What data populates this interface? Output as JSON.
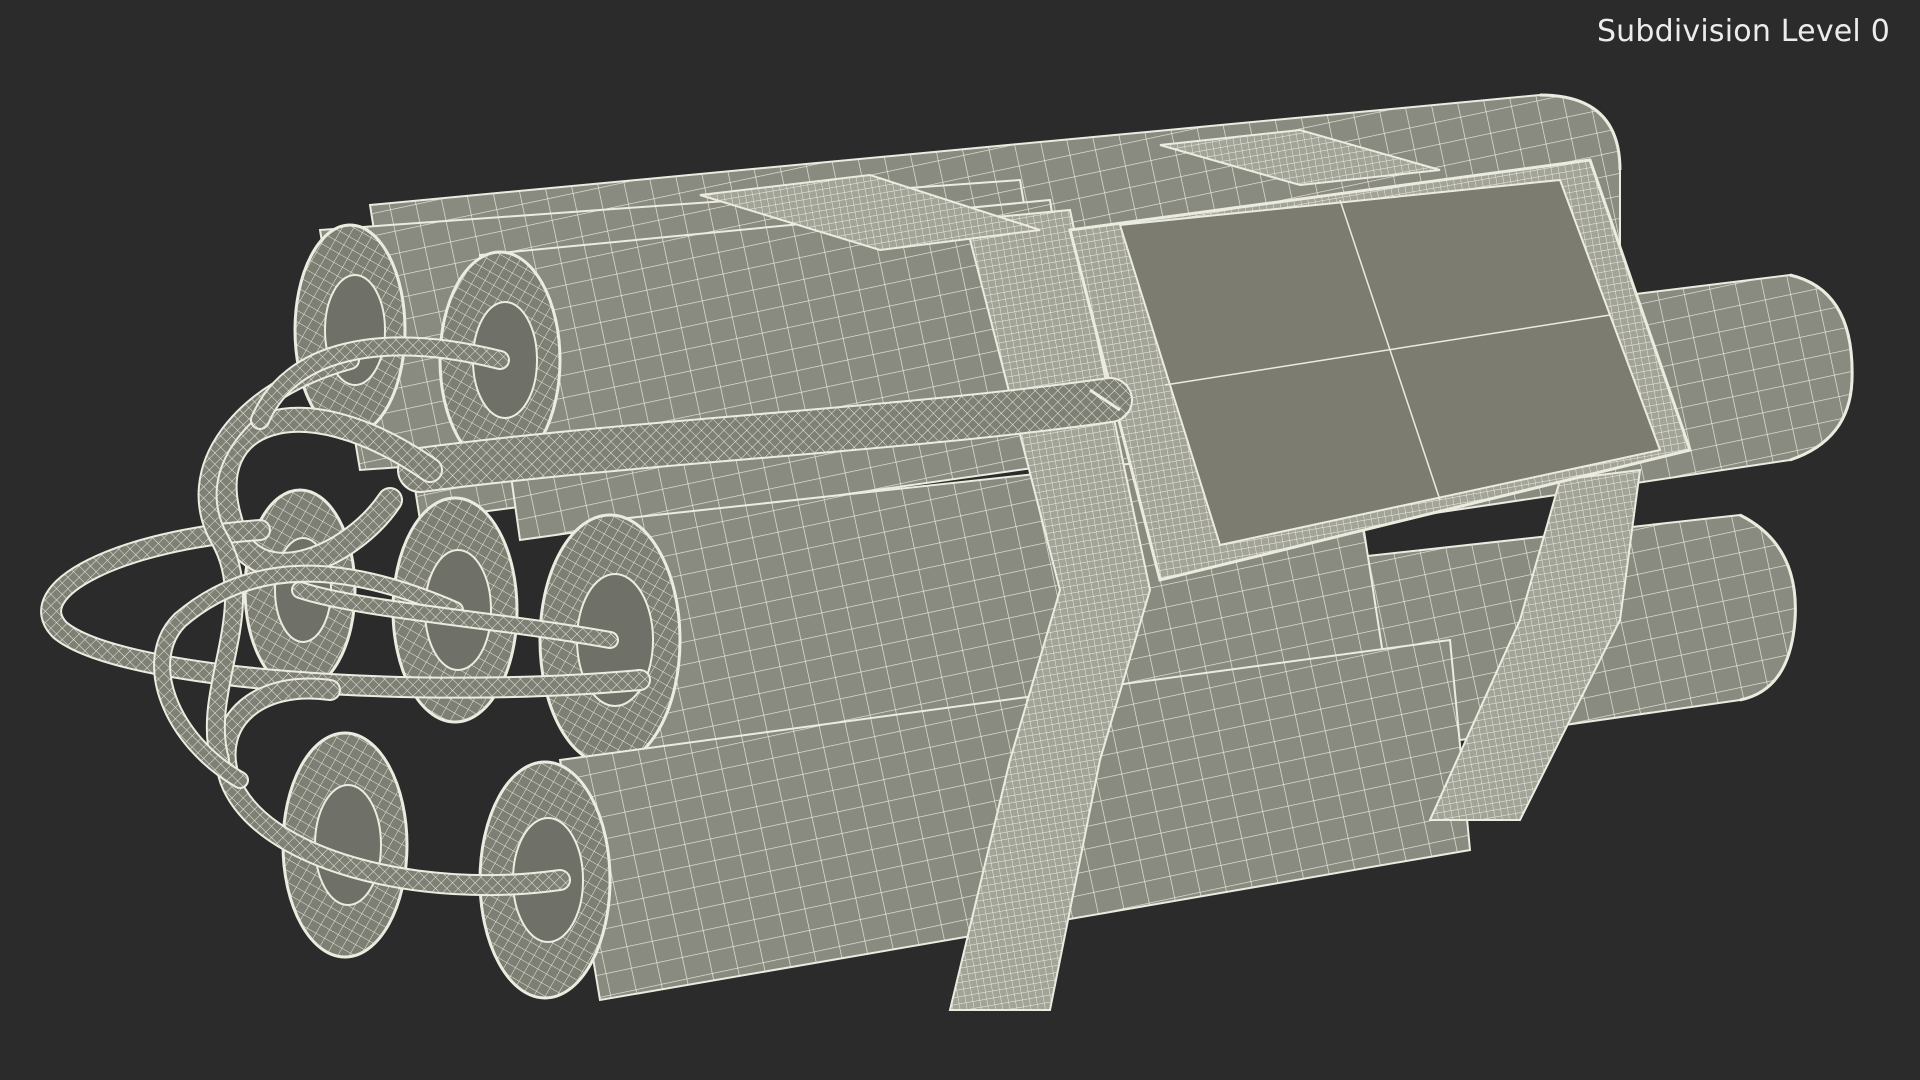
{
  "viewport": {
    "label": "Subdivision Level 0",
    "background_color": "#2b2b2b"
  },
  "model": {
    "render_mode": "wireframe-on-shaded",
    "surface_color": "#8a8b80",
    "wire_color": "#ecebe0"
  }
}
